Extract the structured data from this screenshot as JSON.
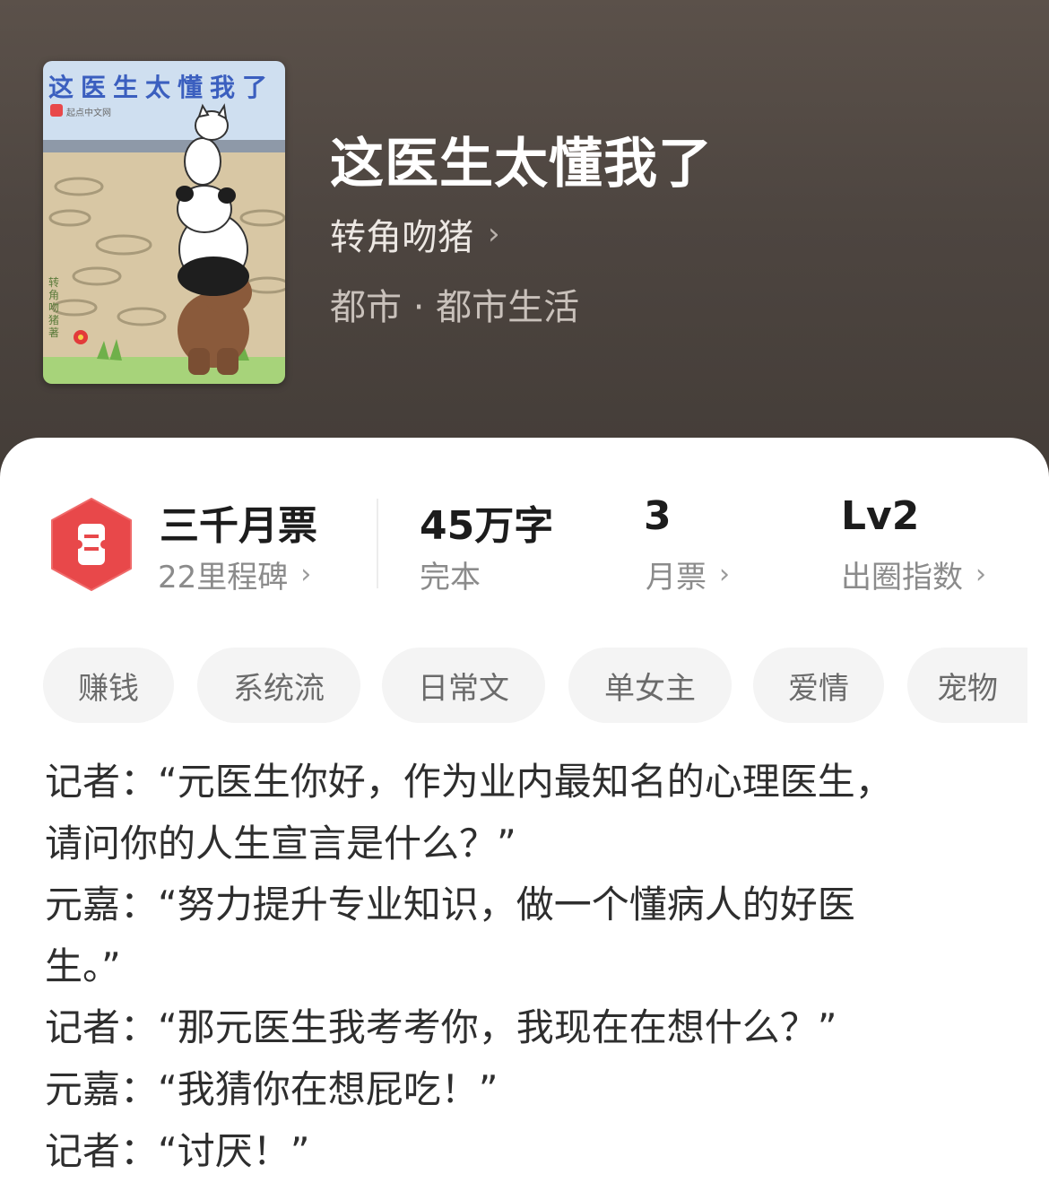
{
  "book": {
    "title": "这医生太懂我了",
    "author": "转角吻猪",
    "genre": "都市 · 都市生活",
    "cover": {
      "title_text": "这医生太懂我了",
      "publisher": "起点中文网",
      "author_signature": "转角吻猪著"
    }
  },
  "stats": {
    "ticket": {
      "title": "三千月票",
      "subtitle": "22里程碑"
    },
    "words": {
      "value": "45万字",
      "label": "完本"
    },
    "monthly": {
      "value": "3",
      "label": "月票"
    },
    "level": {
      "value": "Lv2",
      "label": "出圈指数"
    }
  },
  "tags": [
    "赚钱",
    "系统流",
    "日常文",
    "单女主",
    "爱情",
    "宠物"
  ],
  "description": [
    "记者：“元医生你好，作为业内最知名的心理医生，",
    "请问你的人生宣言是什么？”",
    "元嘉：“努力提升专业知识，做一个懂病人的好医",
    "生。”",
    "记者：“那元医生我考考你，我现在在想什么？”",
    "元嘉：“我猜你在想屁吃！”",
    "记者：“讨厌！”"
  ],
  "icons": {
    "chevron": "chevron-right-icon",
    "ticket": "ticket-icon"
  },
  "colors": {
    "header_bg": "#4d4540",
    "ticket_red": "#e8484a",
    "tag_bg": "#f4f4f4"
  }
}
